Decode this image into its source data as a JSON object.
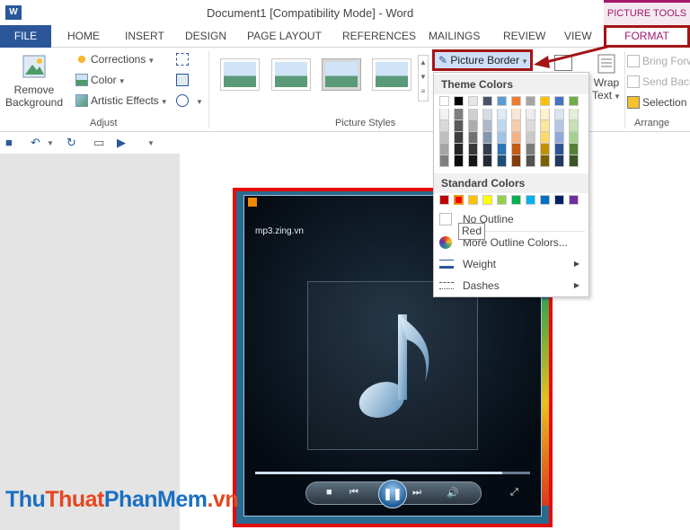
{
  "title": "Document1 [Compatibility Mode] - Word",
  "picture_tools": "PICTURE TOOLS",
  "tabs": [
    "FILE",
    "HOME",
    "INSERT",
    "DESIGN",
    "PAGE LAYOUT",
    "REFERENCES",
    "MAILINGS",
    "REVIEW",
    "VIEW",
    "FORMAT"
  ],
  "ribbon": {
    "remove_bg_1": "Remove",
    "remove_bg_2": "Background",
    "corrections": "Corrections",
    "color": "Color",
    "artistic": "Artistic Effects",
    "adjust": "Adjust",
    "picture_styles": "Picture Styles",
    "picture_border": "Picture Border",
    "wrap_1": "Wrap",
    "wrap_2": "Text",
    "bring_forward": "Bring Forw",
    "send_backward": "Send Back",
    "selection": "Selection",
    "arrange": "Arrange"
  },
  "menu": {
    "theme_colors": "Theme Colors",
    "standard_colors": "Standard Colors",
    "no_outline": "No Outline",
    "more_colors": "More Outline Colors...",
    "weight": "Weight",
    "dashes": "Dashes",
    "tooltip": "Red"
  },
  "theme_rows": [
    [
      "#ffffff",
      "#000000",
      "#e7e6e6",
      "#44546a",
      "#5b9bd5",
      "#ed7d31",
      "#a5a5a5",
      "#ffc000",
      "#4472c4",
      "#70ad47"
    ],
    [
      "#f2f2f2",
      "#7f7f7f",
      "#d0cece",
      "#d6dce4",
      "#deebf6",
      "#fbe5d5",
      "#ededed",
      "#fff2cc",
      "#dae3f3",
      "#e2efd9"
    ],
    [
      "#d8d8d8",
      "#595959",
      "#aeabab",
      "#adb9ca",
      "#bdd7ee",
      "#f7cbac",
      "#dbdbdb",
      "#fee599",
      "#b4c6e7",
      "#c5e0b3"
    ],
    [
      "#bfbfbf",
      "#3f3f3f",
      "#757070",
      "#8496b0",
      "#9dc3e6",
      "#f4b183",
      "#c9c9c9",
      "#ffd965",
      "#8eaadb",
      "#a8d08d"
    ],
    [
      "#a5a5a5",
      "#262626",
      "#3a3838",
      "#323f4f",
      "#2e75b5",
      "#c55a11",
      "#7b7b7b",
      "#bf9000",
      "#2f5496",
      "#538135"
    ],
    [
      "#7f7f7f",
      "#0c0c0c",
      "#171616",
      "#222a35",
      "#1e4e79",
      "#833c0b",
      "#525252",
      "#7f6000",
      "#1f3864",
      "#375623"
    ]
  ],
  "standard_row": [
    "#c00000",
    "#ff0000",
    "#ffc000",
    "#ffff00",
    "#92d050",
    "#00b050",
    "#00b0f0",
    "#0070c0",
    "#002060",
    "#7030a0"
  ],
  "player": {
    "url": "mp3.zing.vn",
    "progress": 0.9
  },
  "watermark": [
    "Thu",
    "Thuat",
    "Phan",
    "Mem",
    ".vn"
  ]
}
